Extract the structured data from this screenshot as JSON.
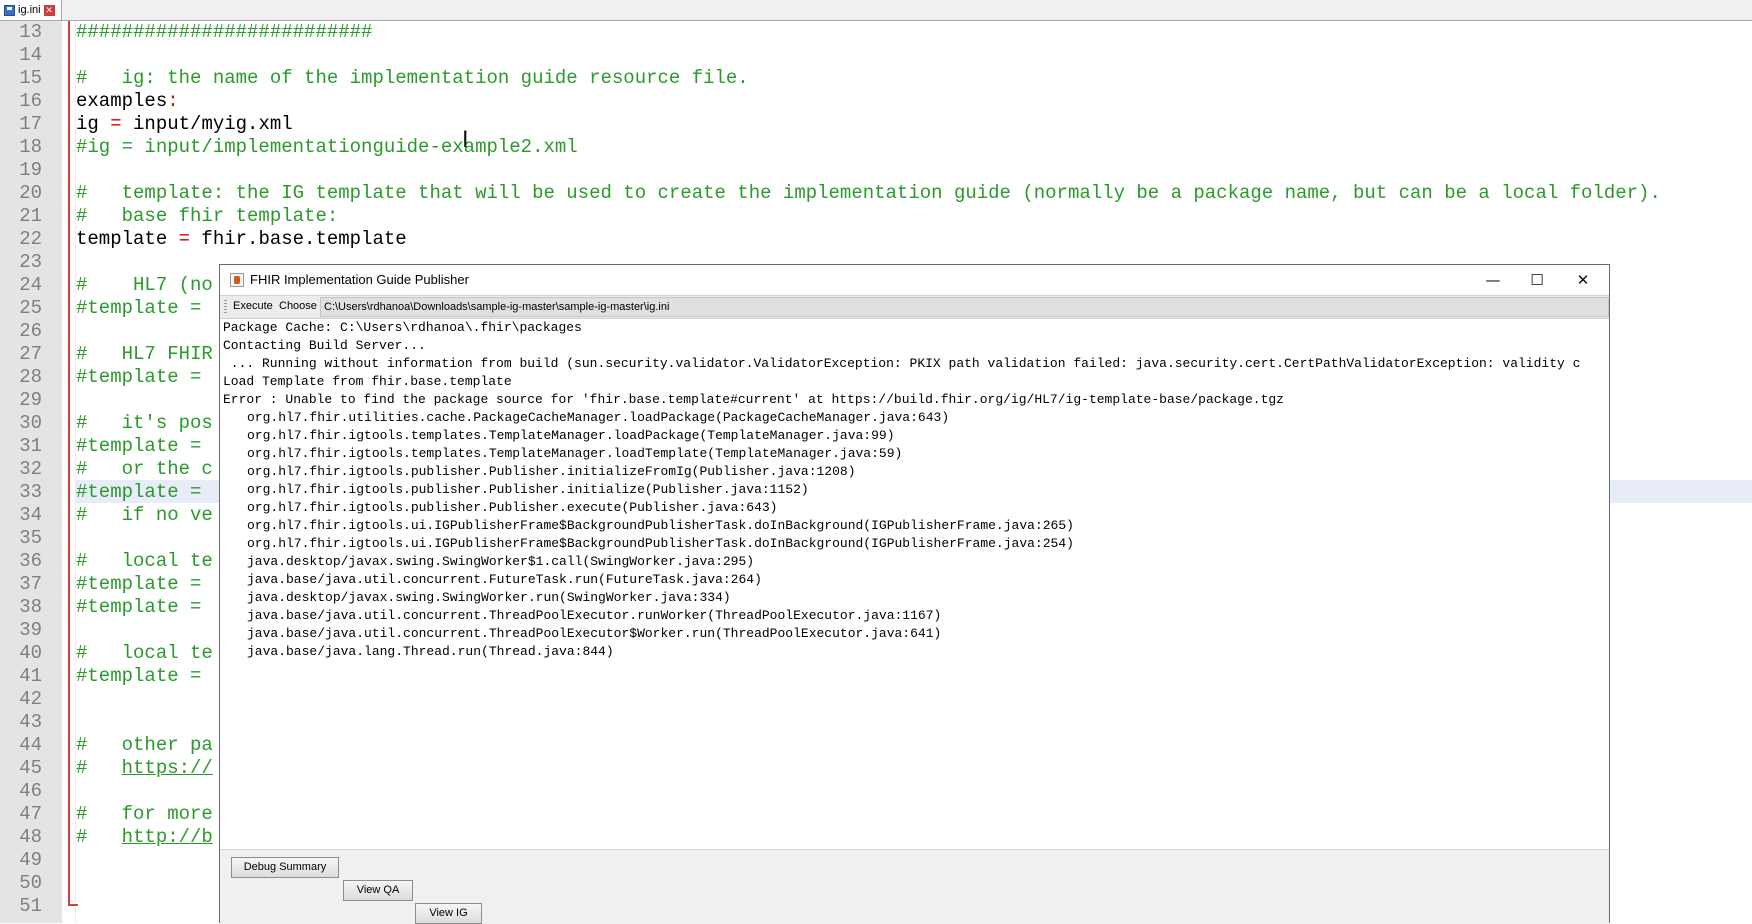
{
  "editor": {
    "tab_label": "ig.ini",
    "lines": [
      {
        "n": "13",
        "segs": [
          {
            "t": "##########################",
            "c": "cm"
          }
        ]
      },
      {
        "n": "14",
        "segs": []
      },
      {
        "n": "15",
        "segs": [
          {
            "t": "#   ig: the name of the implementation guide resource file.",
            "c": "cm"
          }
        ]
      },
      {
        "n": "16",
        "segs": [
          {
            "t": "examples",
            "c": ""
          },
          {
            "t": ":",
            "c": "op"
          }
        ]
      },
      {
        "n": "17",
        "segs": [
          {
            "t": "ig ",
            "c": ""
          },
          {
            "t": "=",
            "c": "op"
          },
          {
            "t": " input/myig.xml",
            "c": ""
          }
        ]
      },
      {
        "n": "18",
        "segs": [
          {
            "t": "#ig = input/implementationguide-example2.xml",
            "c": "cm"
          }
        ]
      },
      {
        "n": "19",
        "segs": []
      },
      {
        "n": "20",
        "segs": [
          {
            "t": "#   template: the IG template that will be used to create the implementation guide (normally be a package name, but can be a local folder).",
            "c": "cm"
          }
        ]
      },
      {
        "n": "21",
        "segs": [
          {
            "t": "#   base fhir template:",
            "c": "cm"
          }
        ]
      },
      {
        "n": "22",
        "segs": [
          {
            "t": "template ",
            "c": ""
          },
          {
            "t": "=",
            "c": "op"
          },
          {
            "t": " fhir.base.template",
            "c": ""
          }
        ]
      },
      {
        "n": "23",
        "segs": []
      },
      {
        "n": "24",
        "segs": [
          {
            "t": "#    HL7 (no",
            "c": "cm"
          }
        ]
      },
      {
        "n": "25",
        "segs": [
          {
            "t": "#template =",
            "c": "cm"
          }
        ]
      },
      {
        "n": "26",
        "segs": []
      },
      {
        "n": "27",
        "segs": [
          {
            "t": "#   HL7 FHIR",
            "c": "cm"
          }
        ]
      },
      {
        "n": "28",
        "segs": [
          {
            "t": "#template =",
            "c": "cm"
          }
        ]
      },
      {
        "n": "29",
        "segs": []
      },
      {
        "n": "30",
        "segs": [
          {
            "t": "#   it's pos",
            "c": "cm"
          }
        ]
      },
      {
        "n": "31",
        "segs": [
          {
            "t": "#template =",
            "c": "cm"
          }
        ]
      },
      {
        "n": "32",
        "segs": [
          {
            "t": "#   or the c",
            "c": "cm"
          }
        ]
      },
      {
        "n": "33",
        "segs": [
          {
            "t": "#template =",
            "c": "cm"
          }
        ]
      },
      {
        "n": "34",
        "segs": [
          {
            "t": "#   if no ve",
            "c": "cm"
          }
        ]
      },
      {
        "n": "35",
        "segs": []
      },
      {
        "n": "36",
        "segs": [
          {
            "t": "#   local te",
            "c": "cm"
          }
        ]
      },
      {
        "n": "37",
        "segs": [
          {
            "t": "#template =",
            "c": "cm"
          }
        ]
      },
      {
        "n": "38",
        "segs": [
          {
            "t": "#template =",
            "c": "cm"
          }
        ]
      },
      {
        "n": "39",
        "segs": []
      },
      {
        "n": "40",
        "segs": [
          {
            "t": "#   local te",
            "c": "cm"
          }
        ]
      },
      {
        "n": "41",
        "segs": [
          {
            "t": "#template =",
            "c": "cm"
          }
        ]
      },
      {
        "n": "42",
        "segs": []
      },
      {
        "n": "43",
        "segs": []
      },
      {
        "n": "44",
        "segs": [
          {
            "t": "#   other pa",
            "c": "cm"
          }
        ]
      },
      {
        "n": "45",
        "segs": [
          {
            "t": "#   ",
            "c": "cm"
          },
          {
            "t": "https://",
            "c": "link"
          }
        ]
      },
      {
        "n": "46",
        "segs": []
      },
      {
        "n": "47",
        "segs": [
          {
            "t": "#   for more",
            "c": "cm"
          }
        ]
      },
      {
        "n": "48",
        "segs": [
          {
            "t": "#   ",
            "c": "cm"
          },
          {
            "t": "http://b",
            "c": "link"
          }
        ]
      },
      {
        "n": "49",
        "segs": []
      },
      {
        "n": "50",
        "segs": []
      },
      {
        "n": "51",
        "segs": []
      }
    ]
  },
  "dialog": {
    "title": "FHIR Implementation Guide Publisher",
    "toolbar": {
      "execute_label": "Execute",
      "choose_label": "Choose",
      "path": "C:\\Users\\rdhanoa\\Downloads\\sample-ig-master\\sample-ig-master\\ig.ini"
    },
    "console_lines": [
      {
        "t": "Package Cache: C:\\Users\\rdhanoa\\.fhir\\packages",
        "trace": false
      },
      {
        "t": "Contacting Build Server...",
        "trace": false
      },
      {
        "t": " ... Running without information from build (sun.security.validator.ValidatorException: PKIX path validation failed: java.security.cert.CertPathValidatorException: validity c",
        "trace": false
      },
      {
        "t": "Load Template from fhir.base.template",
        "trace": false
      },
      {
        "t": "Error : Unable to find the package source for 'fhir.base.template#current' at https://build.fhir.org/ig/HL7/ig-template-base/package.tgz",
        "trace": false
      },
      {
        "t": "org.hl7.fhir.utilities.cache.PackageCacheManager.loadPackage(PackageCacheManager.java:643)",
        "trace": true
      },
      {
        "t": "org.hl7.fhir.igtools.templates.TemplateManager.loadPackage(TemplateManager.java:99)",
        "trace": true
      },
      {
        "t": "org.hl7.fhir.igtools.templates.TemplateManager.loadTemplate(TemplateManager.java:59)",
        "trace": true
      },
      {
        "t": "org.hl7.fhir.igtools.publisher.Publisher.initializeFromIg(Publisher.java:1208)",
        "trace": true
      },
      {
        "t": "org.hl7.fhir.igtools.publisher.Publisher.initialize(Publisher.java:1152)",
        "trace": true
      },
      {
        "t": "org.hl7.fhir.igtools.publisher.Publisher.execute(Publisher.java:643)",
        "trace": true
      },
      {
        "t": "org.hl7.fhir.igtools.ui.IGPublisherFrame$BackgroundPublisherTask.doInBackground(IGPublisherFrame.java:265)",
        "trace": true
      },
      {
        "t": "org.hl7.fhir.igtools.ui.IGPublisherFrame$BackgroundPublisherTask.doInBackground(IGPublisherFrame.java:254)",
        "trace": true
      },
      {
        "t": "java.desktop/javax.swing.SwingWorker$1.call(SwingWorker.java:295)",
        "trace": true
      },
      {
        "t": "java.base/java.util.concurrent.FutureTask.run(FutureTask.java:264)",
        "trace": true
      },
      {
        "t": "java.desktop/javax.swing.SwingWorker.run(SwingWorker.java:334)",
        "trace": true
      },
      {
        "t": "java.base/java.util.concurrent.ThreadPoolExecutor.runWorker(ThreadPoolExecutor.java:1167)",
        "trace": true
      },
      {
        "t": "java.base/java.util.concurrent.ThreadPoolExecutor$Worker.run(ThreadPoolExecutor.java:641)",
        "trace": true
      },
      {
        "t": "java.base/java.lang.Thread.run(Thread.java:844)",
        "trace": true
      }
    ],
    "buttons": {
      "debug_summary": "Debug Summary",
      "view_qa": "View QA",
      "view_ig": "View IG"
    },
    "window_controls": {
      "minimize": "—",
      "maximize": "☐",
      "close": "✕"
    }
  }
}
